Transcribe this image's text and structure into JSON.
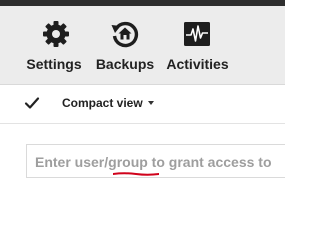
{
  "toolbar": {
    "items": [
      {
        "label": "Settings",
        "icon": "gear-icon"
      },
      {
        "label": "Backups",
        "icon": "backup-restore-icon"
      },
      {
        "label": "Activities",
        "icon": "activity-monitor-icon"
      }
    ]
  },
  "view": {
    "check_icon": "checkmark-icon",
    "label": "Compact view",
    "dropdown_icon": "caret-down-icon"
  },
  "search": {
    "placeholder": "Enter user/group to grant access to",
    "value": ""
  },
  "colors": {
    "toolbar_bg": "#ececec",
    "top_strip": "#2d2d2d",
    "spellcheck_underline": "#d0021b",
    "placeholder_text": "#9e9e9e"
  }
}
